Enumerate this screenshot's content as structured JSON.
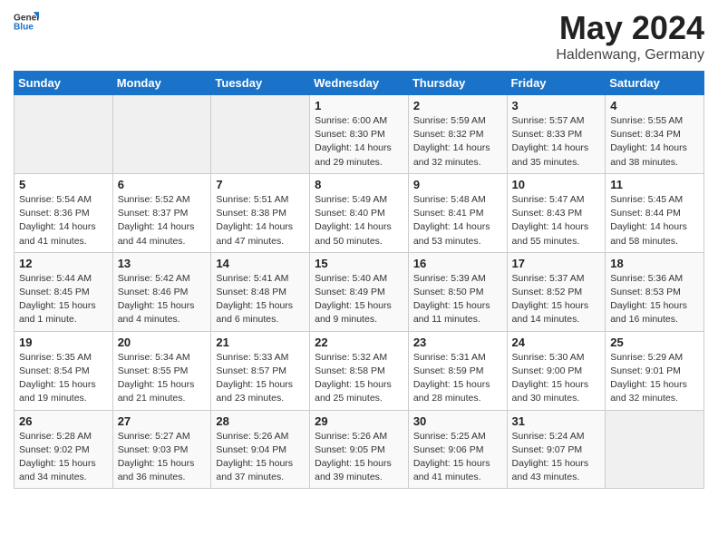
{
  "header": {
    "logo_general": "General",
    "logo_blue": "Blue",
    "main_title": "May 2024",
    "subtitle": "Haldenwang, Germany"
  },
  "calendar": {
    "days_of_week": [
      "Sunday",
      "Monday",
      "Tuesday",
      "Wednesday",
      "Thursday",
      "Friday",
      "Saturday"
    ],
    "weeks": [
      [
        {
          "day": "",
          "info": ""
        },
        {
          "day": "",
          "info": ""
        },
        {
          "day": "",
          "info": ""
        },
        {
          "day": "1",
          "info": "Sunrise: 6:00 AM\nSunset: 8:30 PM\nDaylight: 14 hours\nand 29 minutes."
        },
        {
          "day": "2",
          "info": "Sunrise: 5:59 AM\nSunset: 8:32 PM\nDaylight: 14 hours\nand 32 minutes."
        },
        {
          "day": "3",
          "info": "Sunrise: 5:57 AM\nSunset: 8:33 PM\nDaylight: 14 hours\nand 35 minutes."
        },
        {
          "day": "4",
          "info": "Sunrise: 5:55 AM\nSunset: 8:34 PM\nDaylight: 14 hours\nand 38 minutes."
        }
      ],
      [
        {
          "day": "5",
          "info": "Sunrise: 5:54 AM\nSunset: 8:36 PM\nDaylight: 14 hours\nand 41 minutes."
        },
        {
          "day": "6",
          "info": "Sunrise: 5:52 AM\nSunset: 8:37 PM\nDaylight: 14 hours\nand 44 minutes."
        },
        {
          "day": "7",
          "info": "Sunrise: 5:51 AM\nSunset: 8:38 PM\nDaylight: 14 hours\nand 47 minutes."
        },
        {
          "day": "8",
          "info": "Sunrise: 5:49 AM\nSunset: 8:40 PM\nDaylight: 14 hours\nand 50 minutes."
        },
        {
          "day": "9",
          "info": "Sunrise: 5:48 AM\nSunset: 8:41 PM\nDaylight: 14 hours\nand 53 minutes."
        },
        {
          "day": "10",
          "info": "Sunrise: 5:47 AM\nSunset: 8:43 PM\nDaylight: 14 hours\nand 55 minutes."
        },
        {
          "day": "11",
          "info": "Sunrise: 5:45 AM\nSunset: 8:44 PM\nDaylight: 14 hours\nand 58 minutes."
        }
      ],
      [
        {
          "day": "12",
          "info": "Sunrise: 5:44 AM\nSunset: 8:45 PM\nDaylight: 15 hours\nand 1 minute."
        },
        {
          "day": "13",
          "info": "Sunrise: 5:42 AM\nSunset: 8:46 PM\nDaylight: 15 hours\nand 4 minutes."
        },
        {
          "day": "14",
          "info": "Sunrise: 5:41 AM\nSunset: 8:48 PM\nDaylight: 15 hours\nand 6 minutes."
        },
        {
          "day": "15",
          "info": "Sunrise: 5:40 AM\nSunset: 8:49 PM\nDaylight: 15 hours\nand 9 minutes."
        },
        {
          "day": "16",
          "info": "Sunrise: 5:39 AM\nSunset: 8:50 PM\nDaylight: 15 hours\nand 11 minutes."
        },
        {
          "day": "17",
          "info": "Sunrise: 5:37 AM\nSunset: 8:52 PM\nDaylight: 15 hours\nand 14 minutes."
        },
        {
          "day": "18",
          "info": "Sunrise: 5:36 AM\nSunset: 8:53 PM\nDaylight: 15 hours\nand 16 minutes."
        }
      ],
      [
        {
          "day": "19",
          "info": "Sunrise: 5:35 AM\nSunset: 8:54 PM\nDaylight: 15 hours\nand 19 minutes."
        },
        {
          "day": "20",
          "info": "Sunrise: 5:34 AM\nSunset: 8:55 PM\nDaylight: 15 hours\nand 21 minutes."
        },
        {
          "day": "21",
          "info": "Sunrise: 5:33 AM\nSunset: 8:57 PM\nDaylight: 15 hours\nand 23 minutes."
        },
        {
          "day": "22",
          "info": "Sunrise: 5:32 AM\nSunset: 8:58 PM\nDaylight: 15 hours\nand 25 minutes."
        },
        {
          "day": "23",
          "info": "Sunrise: 5:31 AM\nSunset: 8:59 PM\nDaylight: 15 hours\nand 28 minutes."
        },
        {
          "day": "24",
          "info": "Sunrise: 5:30 AM\nSunset: 9:00 PM\nDaylight: 15 hours\nand 30 minutes."
        },
        {
          "day": "25",
          "info": "Sunrise: 5:29 AM\nSunset: 9:01 PM\nDaylight: 15 hours\nand 32 minutes."
        }
      ],
      [
        {
          "day": "26",
          "info": "Sunrise: 5:28 AM\nSunset: 9:02 PM\nDaylight: 15 hours\nand 34 minutes."
        },
        {
          "day": "27",
          "info": "Sunrise: 5:27 AM\nSunset: 9:03 PM\nDaylight: 15 hours\nand 36 minutes."
        },
        {
          "day": "28",
          "info": "Sunrise: 5:26 AM\nSunset: 9:04 PM\nDaylight: 15 hours\nand 37 minutes."
        },
        {
          "day": "29",
          "info": "Sunrise: 5:26 AM\nSunset: 9:05 PM\nDaylight: 15 hours\nand 39 minutes."
        },
        {
          "day": "30",
          "info": "Sunrise: 5:25 AM\nSunset: 9:06 PM\nDaylight: 15 hours\nand 41 minutes."
        },
        {
          "day": "31",
          "info": "Sunrise: 5:24 AM\nSunset: 9:07 PM\nDaylight: 15 hours\nand 43 minutes."
        },
        {
          "day": "",
          "info": ""
        }
      ]
    ]
  }
}
